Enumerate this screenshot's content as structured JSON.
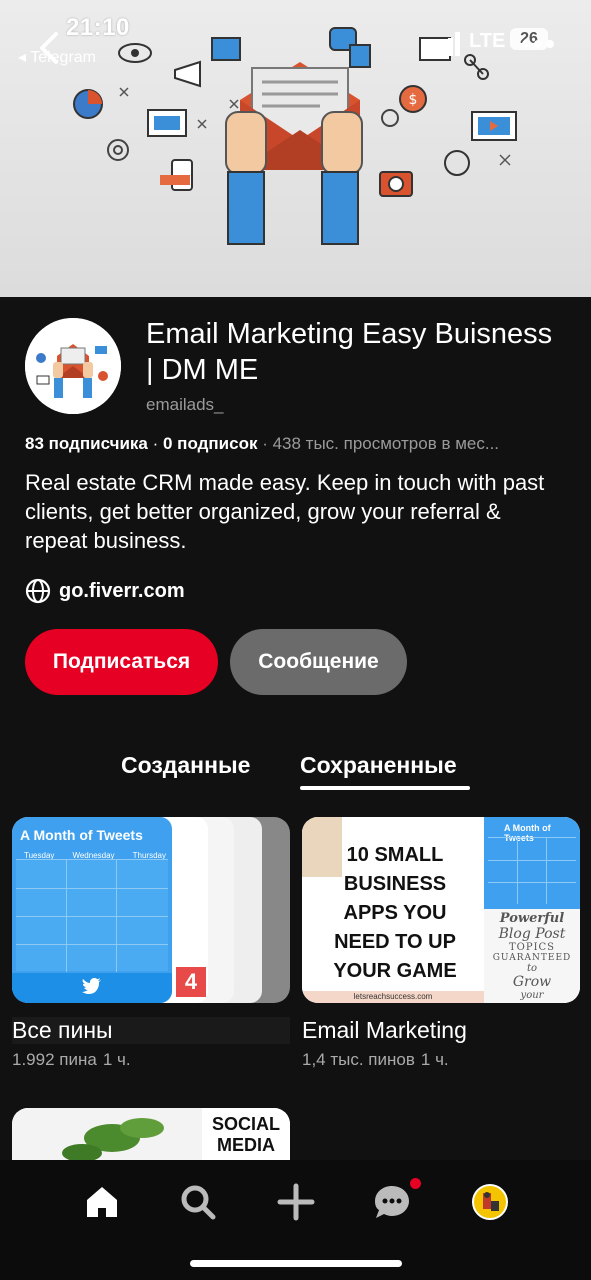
{
  "status_bar": {
    "time": "21:10",
    "back_app": "◂ Telegram",
    "network": "LTE",
    "battery": "26"
  },
  "profile": {
    "name": "Email Marketing Easy Buisness | DM ME",
    "handle": "emailads_",
    "followers": "83 подписчика",
    "following": "0 подписок",
    "views": "438 тыс. просмотров в мес...",
    "bio": "Real estate CRM made easy. Keep in touch with past clients, get better organized, grow your referral & repeat business.",
    "website": "go.fiverr.com"
  },
  "actions": {
    "follow_label": "Подписаться",
    "message_label": "Сообщение"
  },
  "tabs": {
    "created": "Созданные",
    "saved": "Сохраненные",
    "active": "saved"
  },
  "boards": [
    {
      "title": "Все пины",
      "count": "1.992 пина",
      "time": "1 ч.",
      "preview_title": "A Month of Tweets",
      "preview_days": [
        "Tuesday",
        "Wednesday",
        "Thursday"
      ],
      "preview_number": "4"
    },
    {
      "title": "Email Marketing",
      "count": "1,4 тыс. пинов",
      "time": "1 ч.",
      "preview_text": "10 SMALL BUSINESS APPS YOU NEED TO UP YOUR GAME",
      "preview_site": "letsreachsuccess.com",
      "preview_side_title": "A Month of Tweets",
      "preview_side_script": [
        "Powerful",
        "Blog Post",
        "TOPICS",
        "GUARANTEED",
        "to",
        "Grow",
        "your"
      ]
    }
  ],
  "board3": {
    "preview_text": [
      "SOCIAL",
      "MEDIA"
    ]
  },
  "colors": {
    "background": "#111111",
    "accent": "#e60023",
    "secondary_button": "#6b6b6b",
    "muted_text": "#9a9a9a"
  },
  "nav_icons": [
    "home-icon",
    "search-icon",
    "plus-icon",
    "chat-icon",
    "profile-avatar"
  ]
}
